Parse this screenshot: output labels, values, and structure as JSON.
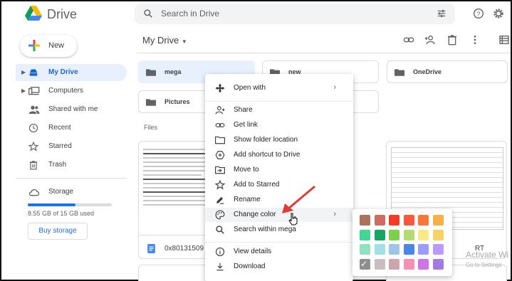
{
  "app": {
    "name": "Drive"
  },
  "search": {
    "placeholder": "Search in Drive"
  },
  "sidebar": {
    "new_label": "New",
    "items": [
      {
        "label": "My Drive",
        "active": true,
        "icon": "my-drive-icon"
      },
      {
        "label": "Computers",
        "icon": "computer-icon"
      },
      {
        "label": "Shared with me",
        "icon": "shared-icon"
      },
      {
        "label": "Recent",
        "icon": "clock-icon"
      },
      {
        "label": "Starred",
        "icon": "star-icon"
      },
      {
        "label": "Trash",
        "icon": "trash-icon"
      }
    ],
    "storage": {
      "label": "Storage",
      "used_text": "8.55 GB of 15 GB used",
      "used_fraction": 0.57
    },
    "buy_label": "Buy storage"
  },
  "main": {
    "title": "My Drive",
    "folders": [
      {
        "label": "mega",
        "selected": true
      },
      {
        "label": "new"
      },
      {
        "label": "OneDrive"
      },
      {
        "label": "Pictures"
      }
    ],
    "files_label": "Files",
    "files": [
      {
        "name": "0x80131509 M"
      },
      {
        "name": "RT"
      }
    ]
  },
  "context_menu": {
    "items": [
      {
        "label": "Open with",
        "icon": "open-with-icon",
        "submenu": true
      },
      {
        "label": "Share",
        "icon": "share-icon"
      },
      {
        "label": "Get link",
        "icon": "link-icon"
      },
      {
        "label": "Show folder location",
        "icon": "folder-icon"
      },
      {
        "label": "Add shortcut to Drive",
        "icon": "add-shortcut-icon"
      },
      {
        "label": "Move to",
        "icon": "move-to-icon"
      },
      {
        "label": "Add to Starred",
        "icon": "star-icon"
      },
      {
        "label": "Rename",
        "icon": "rename-icon"
      },
      {
        "label": "Change color",
        "icon": "palette-icon",
        "submenu": true,
        "hover": true
      },
      {
        "label": "Search within mega",
        "icon": "search-icon"
      },
      {
        "label": "View details",
        "icon": "info-icon"
      },
      {
        "label": "Download",
        "icon": "download-icon"
      }
    ]
  },
  "palette": {
    "colors": [
      "#ac725e",
      "#d06b64",
      "#f83a22",
      "#fa573c",
      "#ff7537",
      "#ffad46",
      "#42d692",
      "#16a765",
      "#7bd148",
      "#b3dc6c",
      "#fbe983",
      "#fad165",
      "#92e1c0",
      "#9fe1e7",
      "#9fc6e7",
      "#4986e7",
      "#9a9cff",
      "#b99aff",
      "#8f8f8f",
      "#cabdbf",
      "#cca6ac",
      "#f691b2",
      "#cd74e6",
      "#a47ae2"
    ],
    "selected_index": 18
  },
  "watermark": {
    "line1": "Activate Wi",
    "line2": "Go to Settings"
  }
}
